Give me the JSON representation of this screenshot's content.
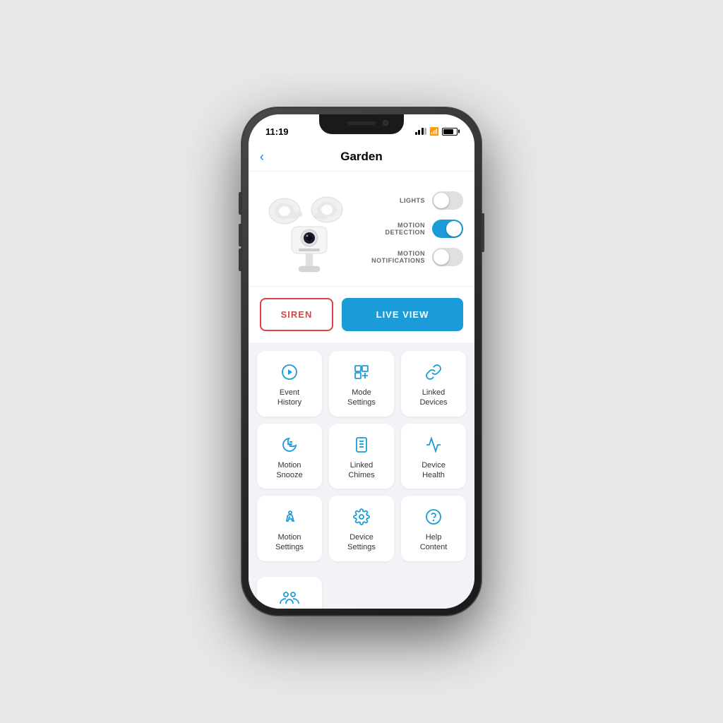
{
  "phone": {
    "status_bar": {
      "time": "11:19",
      "battery_level": 80
    },
    "nav": {
      "back_label": "‹",
      "title": "Garden"
    },
    "controls": {
      "lights_label": "LIGHTS",
      "lights_on": false,
      "motion_detection_label": "MOTION\nDETECTION",
      "motion_detection_on": true,
      "motion_notifications_label": "MOTION\nNOTIFICATIONS",
      "motion_notifications_on": false
    },
    "buttons": {
      "siren_label": "SIREN",
      "live_view_label": "LIVE VIEW"
    },
    "grid": {
      "rows": [
        [
          {
            "id": "event-history",
            "icon": "▶",
            "label": "Event\nHistory"
          },
          {
            "id": "mode-settings",
            "icon": "⊞",
            "label": "Mode\nSettings"
          },
          {
            "id": "linked-devices",
            "icon": "🔗",
            "label": "Linked\nDevices"
          }
        ],
        [
          {
            "id": "motion-snooze",
            "icon": "☾",
            "label": "Motion\nSnooze"
          },
          {
            "id": "linked-chimes",
            "icon": "☰",
            "label": "Linked\nChimes"
          },
          {
            "id": "device-health",
            "icon": "♡",
            "label": "Device\nHealth"
          }
        ],
        [
          {
            "id": "motion-settings",
            "icon": "🏃",
            "label": "Motion\nSettings"
          },
          {
            "id": "device-settings",
            "icon": "⚙",
            "label": "Device\nSettings"
          },
          {
            "id": "help-content",
            "icon": "?",
            "label": "Help\nContent"
          }
        ]
      ],
      "bottom_row": [
        {
          "id": "shared-users",
          "icon": "👥",
          "label": ""
        }
      ]
    }
  }
}
